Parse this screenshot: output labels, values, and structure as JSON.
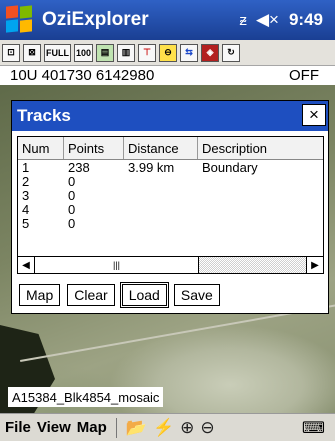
{
  "app": {
    "title": "OziExplorer"
  },
  "tray": {
    "signal": "ᵶ",
    "volume": "◀×",
    "time": "9:49"
  },
  "toolbar": {
    "buttons": [
      {
        "label": "⊡"
      },
      {
        "label": "⊠"
      },
      {
        "label": "FULL"
      },
      {
        "label": "100"
      },
      {
        "label": "▤"
      },
      {
        "label": "▥"
      },
      {
        "label": "⊤"
      },
      {
        "label": "⊖"
      },
      {
        "label": "⇆"
      },
      {
        "label": "◈"
      },
      {
        "label": "↻"
      }
    ]
  },
  "status": {
    "coordinates": "10U 401730 6142980",
    "state": "OFF"
  },
  "map": {
    "label": "A15384_Blk4854_mosaic"
  },
  "dialog": {
    "title": "Tracks",
    "close_label": "×",
    "columns": [
      "Num",
      "Points",
      "Distance",
      "Description"
    ],
    "rows": [
      {
        "num": "1",
        "points": "238",
        "distance": "3.99 km",
        "description": "Boundary"
      },
      {
        "num": "2",
        "points": "0",
        "distance": "",
        "description": ""
      },
      {
        "num": "3",
        "points": "0",
        "distance": "",
        "description": ""
      },
      {
        "num": "4",
        "points": "0",
        "distance": "",
        "description": ""
      },
      {
        "num": "5",
        "points": "0",
        "distance": "",
        "description": ""
      }
    ],
    "scroll": {
      "left": "◀",
      "thumb": "|||",
      "right": "▶"
    },
    "buttons": {
      "map": "Map",
      "clear": "Clear",
      "load": "Load",
      "save": "Save"
    }
  },
  "menubar": {
    "file": "File",
    "view": "View",
    "map": "Map",
    "icons": {
      "open": "📂",
      "gps": "⚡",
      "zoom_in": "⊕",
      "zoom_out": "⊖",
      "keyboard": "⌨"
    }
  }
}
